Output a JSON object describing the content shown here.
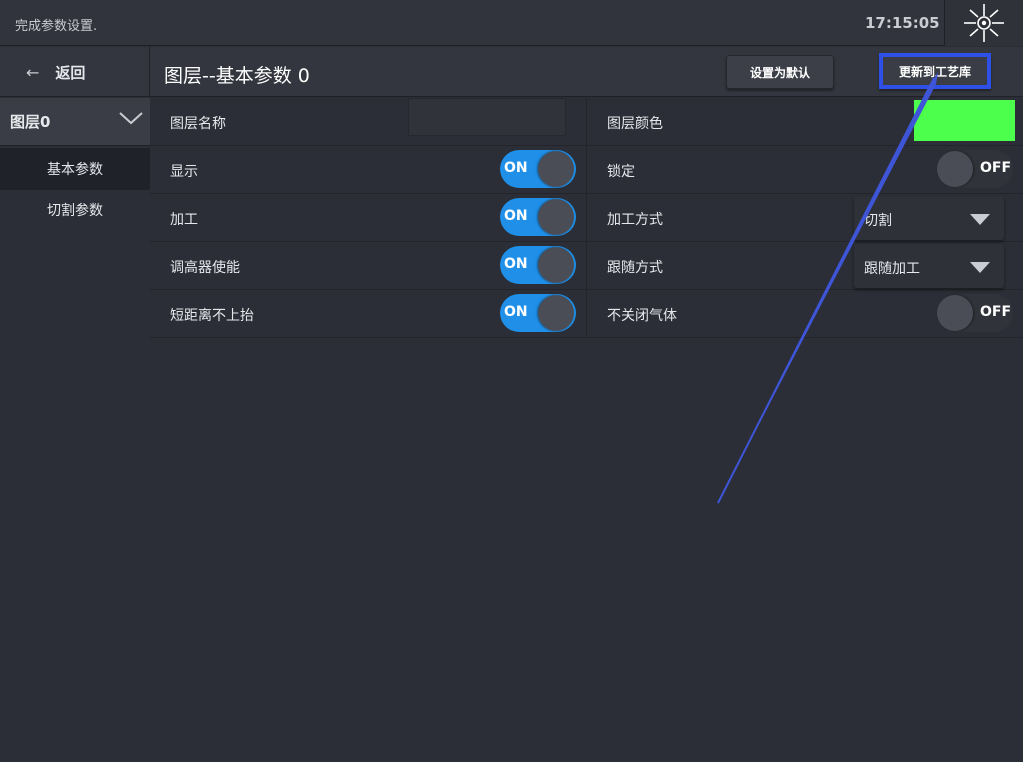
{
  "status": {
    "message": "完成参数设置.",
    "time": "17:15:05"
  },
  "header": {
    "back_label": "返回",
    "title": "图层--基本参数 0",
    "set_default_label": "设置为默认",
    "update_library_label": "更新到工艺库"
  },
  "sidebar": {
    "layer_label": "图层0",
    "items": [
      {
        "label": "基本参数",
        "active": true
      },
      {
        "label": "切割参数",
        "active": false
      }
    ]
  },
  "params": {
    "layer_name": {
      "label": "图层名称",
      "value": ""
    },
    "layer_color": {
      "label": "图层颜色",
      "color": "#4cff4c"
    },
    "display": {
      "label": "显示",
      "state": "ON"
    },
    "lock": {
      "label": "锁定",
      "state": "OFF"
    },
    "process": {
      "label": "加工",
      "state": "ON"
    },
    "process_mode": {
      "label": "加工方式",
      "value": "切割"
    },
    "height_ctrl": {
      "label": "调高器使能",
      "state": "ON"
    },
    "follow_mode": {
      "label": "跟随方式",
      "value": "跟随加工"
    },
    "short_no_lift": {
      "label": "短距离不上抬",
      "state": "ON"
    },
    "gas_keep": {
      "label": "不关闭气体",
      "state": "OFF"
    }
  },
  "colors": {
    "accent": "#1f8fe8",
    "highlight": "#2e50e6",
    "background": "#2b2e36"
  }
}
